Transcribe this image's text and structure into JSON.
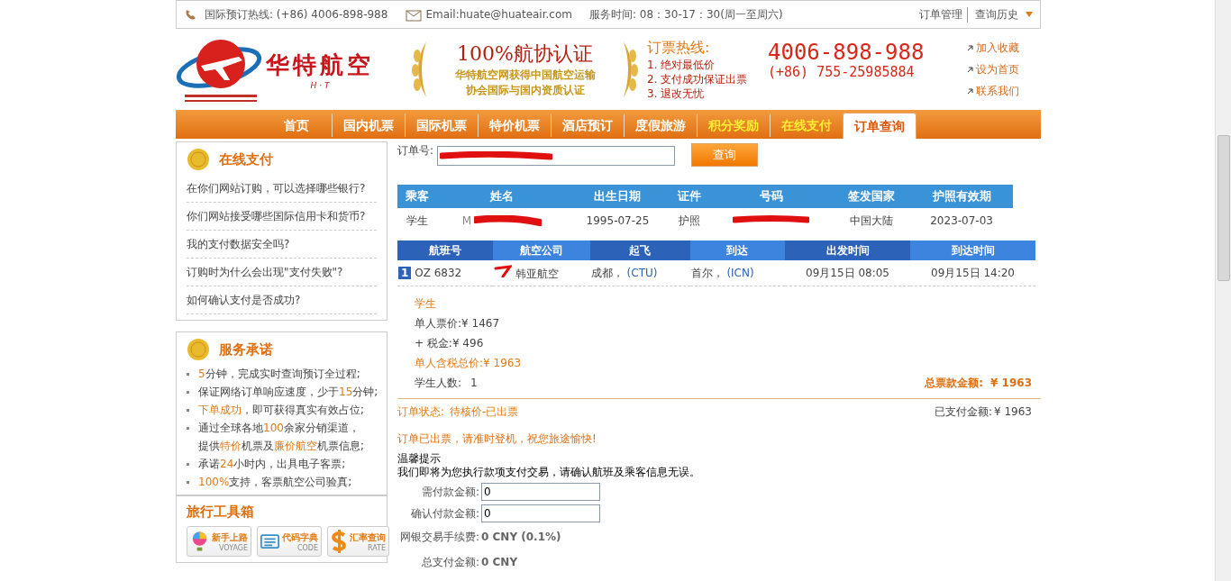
{
  "top_bar": {
    "hotline": "国际预订热线: (+86) 4006-898-988",
    "email": "Email:huate@huateair.com",
    "hours": "服务时间: 08：30-17：30(周一至周六)",
    "links": [
      "订单管理",
      "查询历史"
    ]
  },
  "header": {
    "logo_name": "华特航空",
    "logo_sub": "H · T",
    "cert_title": "100%航协认证",
    "cert_lines": [
      "华特航空网获得中国航空运输",
      "协会国际与国内资质认证"
    ],
    "hotline_label": "订票热线:",
    "hotline_points": [
      "1. 绝对最低价",
      "2. 支付成功保证出票",
      "3. 退改无忧"
    ],
    "phone_main": "4006-898-988",
    "phone_alt": "(+86) 755-25985884",
    "quick_links": [
      "加入收藏",
      "设为首页",
      "联系我们"
    ]
  },
  "nav": [
    {
      "label": "首页",
      "selected": false,
      "highlight": false
    },
    {
      "label": "国内机票",
      "selected": false,
      "highlight": false
    },
    {
      "label": "国际机票",
      "selected": false,
      "highlight": false
    },
    {
      "label": "特价机票",
      "selected": false,
      "highlight": false
    },
    {
      "label": "酒店预订",
      "selected": false,
      "highlight": false
    },
    {
      "label": "度假旅游",
      "selected": false,
      "highlight": false
    },
    {
      "label": "积分奖励",
      "selected": false,
      "highlight": true
    },
    {
      "label": "在线支付",
      "selected": false,
      "highlight": true
    },
    {
      "label": "订单查询",
      "selected": true,
      "highlight": false
    }
  ],
  "sidebar": {
    "faq": {
      "title": "在线支付",
      "questions": [
        "在你们网站订购，可以选择哪些银行?",
        "你们网站接受哪些国际信用卡和货币?",
        "我的支付数据安全吗?",
        "订购时为什么会出现\"支付失败\"?",
        "如何确认支付是否成功?"
      ]
    },
    "service": {
      "title": "服务承诺",
      "items": [
        {
          "lines": [
            [
              {
                "text": "5",
                "accent": true
              },
              {
                "text": "分钟，完成实时查询预订全过程;",
                "accent": false
              }
            ]
          ]
        },
        {
          "lines": [
            [
              {
                "text": "保证网络订单响应速度，少于",
                "accent": false
              },
              {
                "text": "15",
                "accent": true
              },
              {
                "text": "分钟;",
                "accent": false
              }
            ]
          ]
        },
        {
          "lines": [
            [
              {
                "text": "下单成功",
                "accent": true
              },
              {
                "text": "，即可获得真实有效占位;",
                "accent": false
              }
            ]
          ]
        },
        {
          "lines": [
            [
              {
                "text": "通过全球各地",
                "accent": false
              },
              {
                "text": "100",
                "accent": true
              },
              {
                "text": "余家分销渠道，",
                "accent": false
              }
            ],
            [
              {
                "text": "提供",
                "accent": false
              },
              {
                "text": "特价",
                "accent": true
              },
              {
                "text": "机票及",
                "accent": false
              },
              {
                "text": "廉价航空",
                "accent": true
              },
              {
                "text": "机票信息;",
                "accent": false
              }
            ]
          ]
        },
        {
          "lines": [
            [
              {
                "text": "承诺",
                "accent": false
              },
              {
                "text": "24",
                "accent": true
              },
              {
                "text": "小时内，出具电子客票;",
                "accent": false
              }
            ]
          ]
        },
        {
          "lines": [
            [
              {
                "text": "100%",
                "accent": true
              },
              {
                "text": "支持，客票航空公司验真;",
                "accent": false
              }
            ]
          ]
        }
      ]
    },
    "toolbox": {
      "title": "旅行工具箱",
      "tools": [
        {
          "kind": "balloon",
          "label": "新手上路",
          "sub": "VOYAGE"
        },
        {
          "kind": "list",
          "label": "代码字典",
          "sub": "CODE"
        },
        {
          "kind": "dollar",
          "label": "汇率查询",
          "sub": "RATE"
        }
      ]
    }
  },
  "order": {
    "label": "订单号:",
    "search_button": "查询"
  },
  "passengers": {
    "columns": [
      "乘客",
      "姓名",
      "出生日期",
      "证件",
      "号码",
      "签发国家",
      "护照有效期"
    ],
    "rows": [
      {
        "type": "学生",
        "name": "M",
        "birth_date": "1995-07-25",
        "document": "护照",
        "issuing_country": "中国大陆",
        "expiry": "2023-07-03"
      }
    ]
  },
  "flights": {
    "columns": [
      "航班号",
      "航空公司",
      "起飞",
      "到达",
      "出发时间",
      "到达时间"
    ],
    "rows": [
      {
        "index": "1",
        "flight": "OZ 6832",
        "airline": "韩亚航空",
        "from": "成都，",
        "from_code": "(CTU)",
        "to": "首尔，",
        "to_code": "(ICN)",
        "depart": "09月15日 08:05",
        "arrive": "09月15日 14:20"
      }
    ]
  },
  "pricing": {
    "category": "学生",
    "unit_price": "单人票价:¥ 1467",
    "tax": "+ 税金:¥ 496",
    "total_each": "单人含税总价:¥ 1963",
    "count_label": "学生人数:",
    "count": "1",
    "grand_label": "总票款金额:",
    "grand_value": "¥ 1963"
  },
  "status": {
    "label": "订单状态:",
    "value": "待核价-已出票",
    "paid_label": "已支付金额:",
    "paid_value": "¥ 1963",
    "notice": "订单已出票，请准时登机，祝您旅途愉快!"
  },
  "payment": {
    "tip_title": "温馨提示",
    "tip_text": "我们即将为您执行款项支付交易，请确认航班及乘客信息无误。",
    "fields": [
      {
        "kind": "input",
        "label": "需付款金额:",
        "value": "0"
      },
      {
        "kind": "input",
        "label": "确认付款金额:",
        "value": "0"
      },
      {
        "kind": "text",
        "label": "网银交易手续费:",
        "value": "0 CNY (0.1%)"
      },
      {
        "kind": "text",
        "label": "总支付金额:",
        "value": "0 CNY"
      }
    ]
  }
}
